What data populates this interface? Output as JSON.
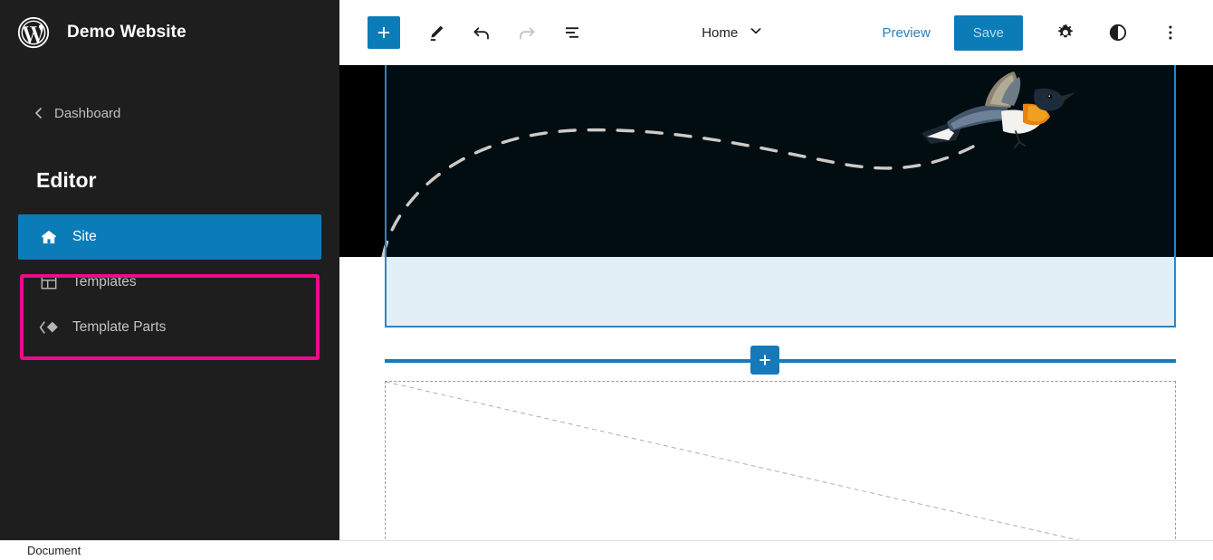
{
  "sidebar": {
    "logo_icon": "wordpress-logo-icon",
    "site_title": "Demo Website",
    "back_link": {
      "label": "Dashboard",
      "icon": "chevron-left-icon"
    },
    "heading": "Editor",
    "items": [
      {
        "label": "Site",
        "icon": "home-icon",
        "active": true
      },
      {
        "label": "Templates",
        "icon": "layout-grid-icon",
        "active": false
      },
      {
        "label": "Template Parts",
        "icon": "template-parts-icon",
        "active": false
      }
    ],
    "annotation": {
      "color": "#f0098d",
      "covers": "Templates and Template Parts"
    },
    "background_color": "#1e1e1e",
    "active_color": "#0b7cb8"
  },
  "toolbar": {
    "add_block": {
      "label": "+",
      "icon": "plus-icon"
    },
    "tools": [
      {
        "name": "edit-pencil-icon",
        "state": "active"
      },
      {
        "name": "undo-icon",
        "state": "enabled"
      },
      {
        "name": "redo-icon",
        "state": "disabled"
      },
      {
        "name": "list-view-icon",
        "state": "enabled"
      }
    ],
    "document_switcher": {
      "label": "Home",
      "icon": "chevron-down-icon"
    },
    "preview_label": "Preview",
    "save_label": "Save",
    "settings_icon": "gear-icon",
    "styles_icon": "contrast-half-circle-icon",
    "more_icon": "three-dots-vertical-icon",
    "accent_color": "#0b7cb8"
  },
  "canvas": {
    "hero": {
      "type": "image-block",
      "background_color": "#020d12",
      "selected": true,
      "selection_color": "#2a86c5",
      "selected_fill_color": "#e3eff6",
      "bird_illustration": "flycatcher-bird-icon",
      "flight_path": "dashed-curve"
    },
    "inserter": {
      "icon": "plus-icon",
      "color": "#1579ba"
    },
    "placeholder": {
      "type": "empty-block-placeholder",
      "border": "dashed"
    }
  },
  "statusbar": {
    "breadcrumb": "Document"
  }
}
